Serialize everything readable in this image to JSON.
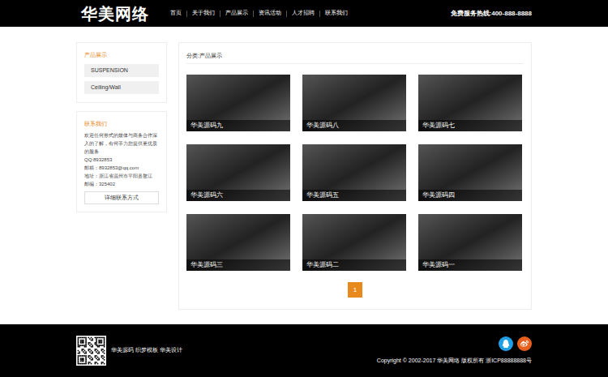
{
  "header": {
    "logo": "华美网络",
    "nav": [
      {
        "label": "首页",
        "selected": false
      },
      {
        "label": "关于我们",
        "selected": false
      },
      {
        "label": "产品展示",
        "selected": false
      },
      {
        "label": "资讯活动",
        "selected": false
      },
      {
        "label": "人才招聘",
        "selected": false
      },
      {
        "label": "联系我们",
        "selected": false
      }
    ],
    "hotline": "免费服务热线:400-888-8888"
  },
  "sidebar": {
    "products": {
      "title": "产品展示",
      "items": [
        "SUSPENSION",
        "Ceiling/Wall"
      ]
    },
    "contact": {
      "title": "联系我们",
      "intro": "欢迎任何形式的媒体与商务合作深入的了解，有何手力您提供更优质的服务",
      "lines": [
        "QQ:8932853",
        "邮箱：8932853@qq.com",
        "地址：浙江省温州市平阳县鳌江",
        "邮编：325402"
      ],
      "button": "详细联系方式"
    }
  },
  "main": {
    "breadcrumb": "分类:产品展示",
    "products": [
      "华美源码九",
      "华美源码八",
      "华美源码七",
      "华美源码六",
      "华美源码五",
      "华美源码四",
      "华美源码三",
      "华美源码二",
      "华美源码一"
    ],
    "pagination": [
      {
        "label": "1",
        "selected": true
      }
    ]
  },
  "footer": {
    "links": "华美源码 织梦模板 华美设计",
    "copyright": "Copyright © 2002-2017 华美网络 版权所有 浙ICP88888888号"
  }
}
